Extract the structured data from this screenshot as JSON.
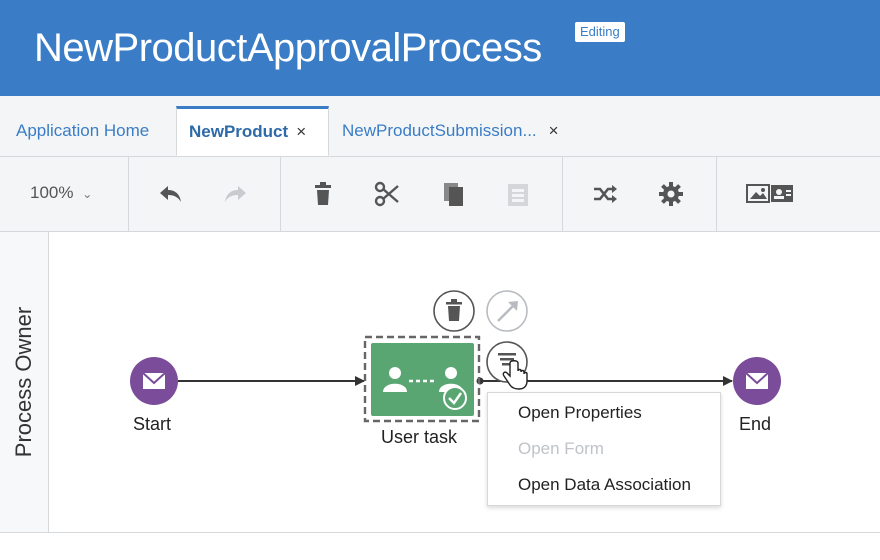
{
  "header": {
    "title": "NewProductApprovalProcess",
    "badge": "Editing",
    "color": "#3a7dc6"
  },
  "tabs": [
    {
      "label": "Application Home",
      "active": false
    },
    {
      "label": "NewProduct",
      "active": true,
      "close": "×"
    },
    {
      "label": "NewProductSubmission...",
      "active": false,
      "close": "×"
    }
  ],
  "toolbar": {
    "zoom": "100%",
    "icons": [
      "undo-icon",
      "redo-icon",
      "delete-icon",
      "cut-icon",
      "copy-icon",
      "paste-icon",
      "shuffle-icon",
      "gear-icon",
      "image-card-icon"
    ]
  },
  "lane": {
    "label": "Process Owner"
  },
  "diagram": {
    "start_label": "Start",
    "task_label": "User task",
    "end_label": "End",
    "event_color": "#7b4c9a",
    "task_color": "#5aa672"
  },
  "context_menu": {
    "items": [
      {
        "label": "Open Properties",
        "enabled": true
      },
      {
        "label": "Open Form",
        "enabled": false
      },
      {
        "label": "Open Data Association",
        "enabled": true
      }
    ]
  }
}
